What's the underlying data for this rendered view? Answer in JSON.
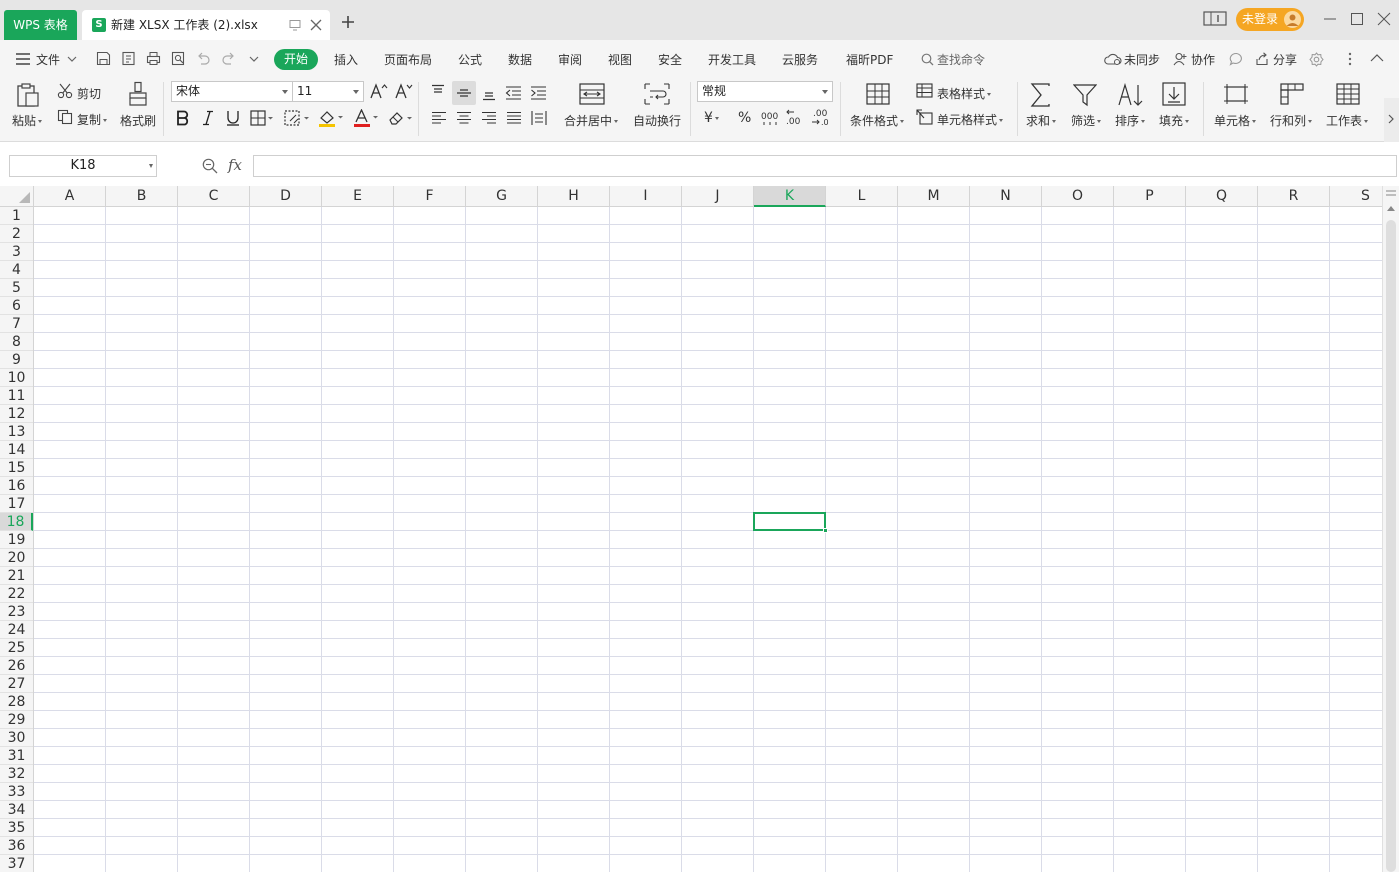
{
  "titlebar": {
    "app_tab": "WPS 表格",
    "file_tab": {
      "icon_letter": "S",
      "name": "新建 XLSX 工作表 (2).xlsx"
    },
    "login": "未登录"
  },
  "menubar": {
    "file": "文件",
    "tabs": [
      {
        "id": "insert",
        "label": "插入"
      },
      {
        "id": "page-layout",
        "label": "页面布局"
      },
      {
        "id": "formula",
        "label": "公式"
      },
      {
        "id": "data",
        "label": "数据"
      },
      {
        "id": "review",
        "label": "审阅"
      },
      {
        "id": "view",
        "label": "视图"
      },
      {
        "id": "security",
        "label": "安全"
      },
      {
        "id": "dev-tools",
        "label": "开发工具"
      },
      {
        "id": "cloud",
        "label": "云服务"
      },
      {
        "id": "foxit-pdf",
        "label": "福昕PDF"
      }
    ],
    "active_tab": "开始",
    "search": "查找命令",
    "unsynced": "未同步",
    "collaborate": "协作",
    "share": "分享"
  },
  "ribbon": {
    "paste": "粘贴",
    "cut": "剪切",
    "copy": "复制",
    "format_painter": "格式刷",
    "font_name": "宋体",
    "font_size": "11",
    "merge_center": "合并居中",
    "wrap_text": "自动换行",
    "number_format": "常规",
    "conditional_format": "条件格式",
    "table_style": "表格样式",
    "cell_style": "单元格样式",
    "sum": "求和",
    "filter": "筛选",
    "sort": "排序",
    "fill": "填充",
    "cells": "单元格",
    "rows_cols": "行和列",
    "worksheet": "工作表",
    "currency_symbol": "¥",
    "percent_symbol": "%"
  },
  "formulabar": {
    "name_box": "K18",
    "fx": "fx",
    "formula": ""
  },
  "grid": {
    "columns": [
      "A",
      "B",
      "C",
      "D",
      "E",
      "F",
      "G",
      "H",
      "I",
      "J",
      "K",
      "L",
      "M",
      "N",
      "O",
      "P",
      "Q",
      "R",
      "S"
    ],
    "rows": [
      "1",
      "2",
      "3",
      "4",
      "5",
      "6",
      "7",
      "8",
      "9",
      "10",
      "11",
      "12",
      "13",
      "14",
      "15",
      "16",
      "17",
      "18",
      "19",
      "20",
      "21",
      "22",
      "23",
      "24",
      "25",
      "26",
      "27",
      "28",
      "29",
      "30",
      "31",
      "32",
      "33",
      "34",
      "35",
      "36",
      "37"
    ],
    "selected_column": "K",
    "selected_row": "18"
  },
  "colors": {
    "accent": "#1aa65a",
    "login": "#f5a623"
  }
}
